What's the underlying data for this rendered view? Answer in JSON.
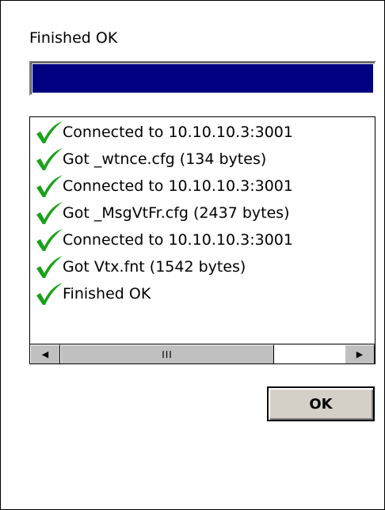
{
  "dialog": {
    "status_text": "Finished OK",
    "progress_fraction": 1.0,
    "progress_color": "#000080"
  },
  "log": {
    "check_icon": "green-check-icon",
    "check_color": "#1aa11a",
    "items": [
      "Connected to 10.10.10.3:3001",
      "Got _wtnce.cfg (134 bytes)",
      "Connected to 10.10.10.3:3001",
      "Got _MsgVtFr.cfg (2437 bytes)",
      "Connected to 10.10.10.3:3001",
      "Got Vtx.fnt (1542 bytes)",
      "Finished OK"
    ]
  },
  "scrollbar": {
    "left_icon": "arrow-left-icon",
    "right_icon": "arrow-right-icon",
    "grip_glyph": "III"
  },
  "buttons": {
    "ok_label": "OK"
  }
}
